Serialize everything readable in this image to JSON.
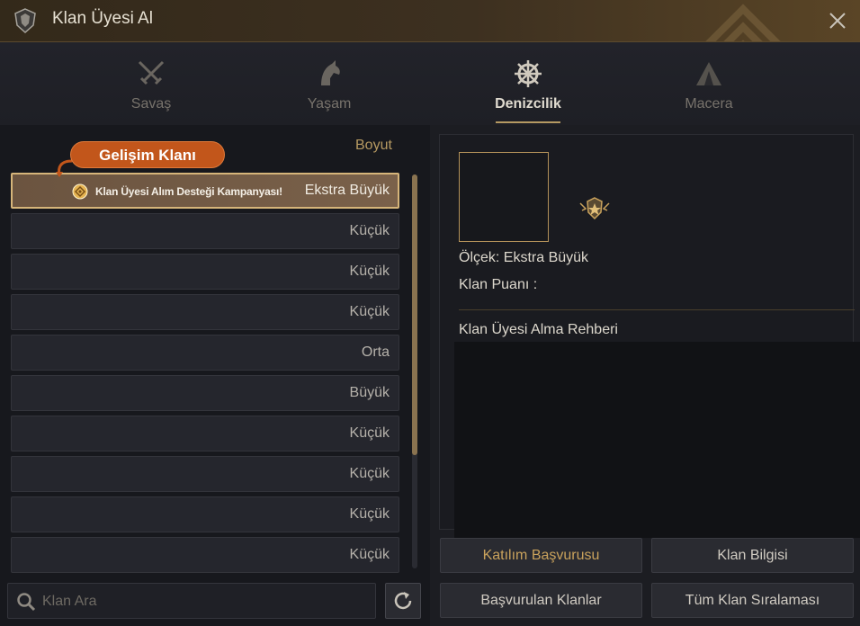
{
  "window": {
    "title": "Klan Üyesi Al"
  },
  "tabs": [
    {
      "label": "Savaş",
      "icon": "crossed-swords-icon",
      "active": false
    },
    {
      "label": "Yaşam",
      "icon": "horse-head-icon",
      "active": false
    },
    {
      "label": "Denizcilik",
      "icon": "ship-wheel-icon",
      "active": true
    },
    {
      "label": "Macera",
      "icon": "tent-icon",
      "active": false
    }
  ],
  "list": {
    "size_header": "Boyut",
    "badge": "Gelişim Klanı",
    "promo_text": "Klan Üyesi Alım Desteği Kampanyası!",
    "rows": [
      {
        "size": "Ekstra Büyük"
      },
      {
        "size": "Küçük"
      },
      {
        "size": "Küçük"
      },
      {
        "size": "Küçük"
      },
      {
        "size": "Orta"
      },
      {
        "size": "Büyük"
      },
      {
        "size": "Küçük"
      },
      {
        "size": "Küçük"
      },
      {
        "size": "Küçük"
      },
      {
        "size": "Küçük"
      }
    ],
    "search_placeholder": "Klan Ara"
  },
  "detail": {
    "scale": "Ölçek: Ekstra Büyük",
    "points": "Klan Puanı :",
    "guide_title": "Klan Üyesi Alma Rehberi"
  },
  "buttons": {
    "apply": "Katılım Başvurusu",
    "info": "Klan Bilgisi",
    "applied": "Başvurulan Klanlar",
    "ranking": "Tüm Klan Sıralaması"
  },
  "colors": {
    "accent_gold": "#c9a25c",
    "badge_orange": "#c2561b",
    "selected_border": "#d6b57a"
  }
}
